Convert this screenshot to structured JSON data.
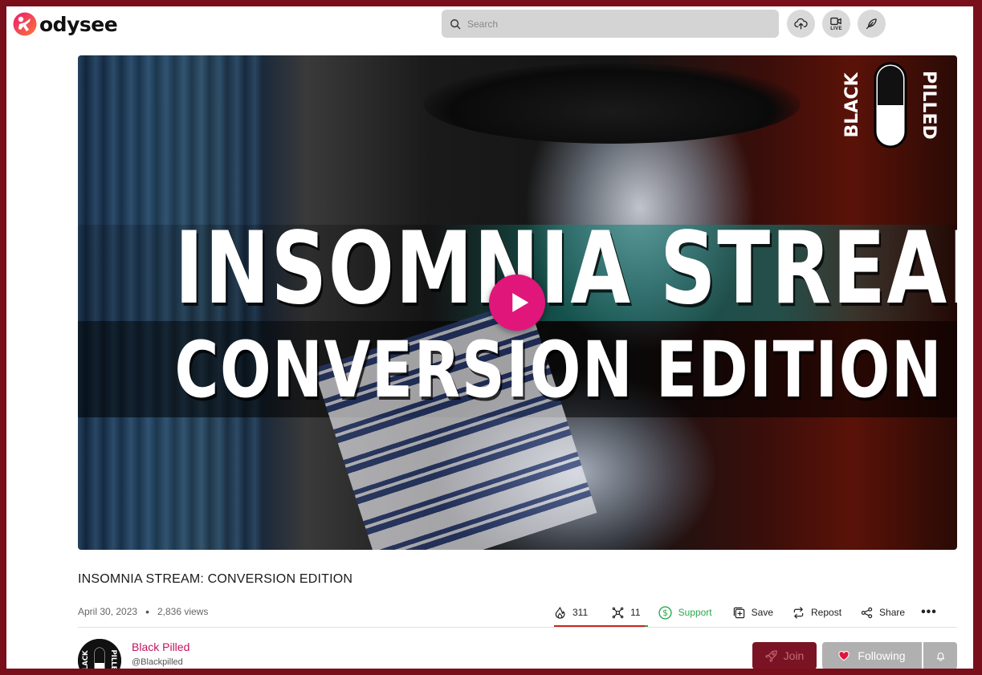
{
  "header": {
    "logo_text": "odysee",
    "search_placeholder": "Search",
    "live_label": "LIVE"
  },
  "video": {
    "thumbnail_line1": "INSOMNIA STREAM",
    "thumbnail_line2": "CONVERSION EDITION",
    "badge_left": "BLACK",
    "badge_right": "PILLED"
  },
  "info": {
    "title": "INSOMNIA STREAM: CONVERSION EDITION",
    "date": "April 30, 2023",
    "views": "2,836 views"
  },
  "actions": {
    "fire_count": "311",
    "slime_count": "11",
    "support_label": "Support",
    "save_label": "Save",
    "repost_label": "Repost",
    "share_label": "Share",
    "more_label": "•••"
  },
  "channel": {
    "name": "Black Pilled",
    "handle": "@Blackpilled",
    "avatar_text_left": "BLACK",
    "avatar_text_right": "PILLED",
    "join_label": "Join",
    "following_label": "Following"
  },
  "colors": {
    "brand_pink": "#e0167a",
    "frame": "#7a0f1c",
    "support_green": "#2aa84a",
    "channel_pink": "#c4125f",
    "fire_underline": "#c8281e"
  }
}
